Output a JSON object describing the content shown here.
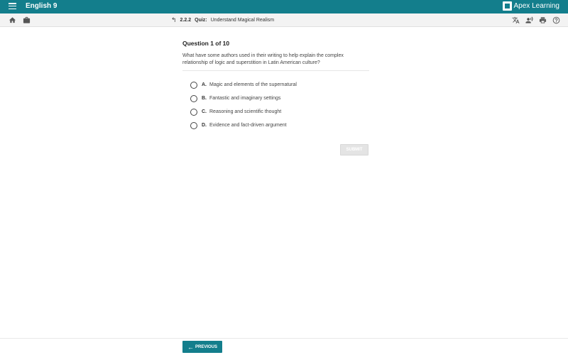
{
  "header": {
    "course_title": "English 9",
    "brand": "Apex Learning",
    "accent_color": "#137e8c"
  },
  "subbar": {
    "lesson_number": "2.2.2",
    "lesson_type": "Quiz:",
    "lesson_title": "Understand Magical Realism",
    "icons": [
      "home-icon",
      "briefcase-icon",
      "translate-icon",
      "read-aloud-icon",
      "print-icon",
      "help-icon"
    ]
  },
  "question": {
    "number_label": "Question 1 of 10",
    "text": "What have some authors used in their writing to help explain the complex relationship of logic and superstition in Latin American culture?",
    "options": [
      {
        "letter": "A.",
        "text": "Magic and elements of the supernatural"
      },
      {
        "letter": "B.",
        "text": "Fantastic and imaginary settings"
      },
      {
        "letter": "C.",
        "text": "Reasoning and scientific thought"
      },
      {
        "letter": "D.",
        "text": "Evidence and fact-driven argument"
      }
    ],
    "submit_label": "SUBMIT"
  },
  "footer": {
    "previous_label": "PREVIOUS"
  }
}
